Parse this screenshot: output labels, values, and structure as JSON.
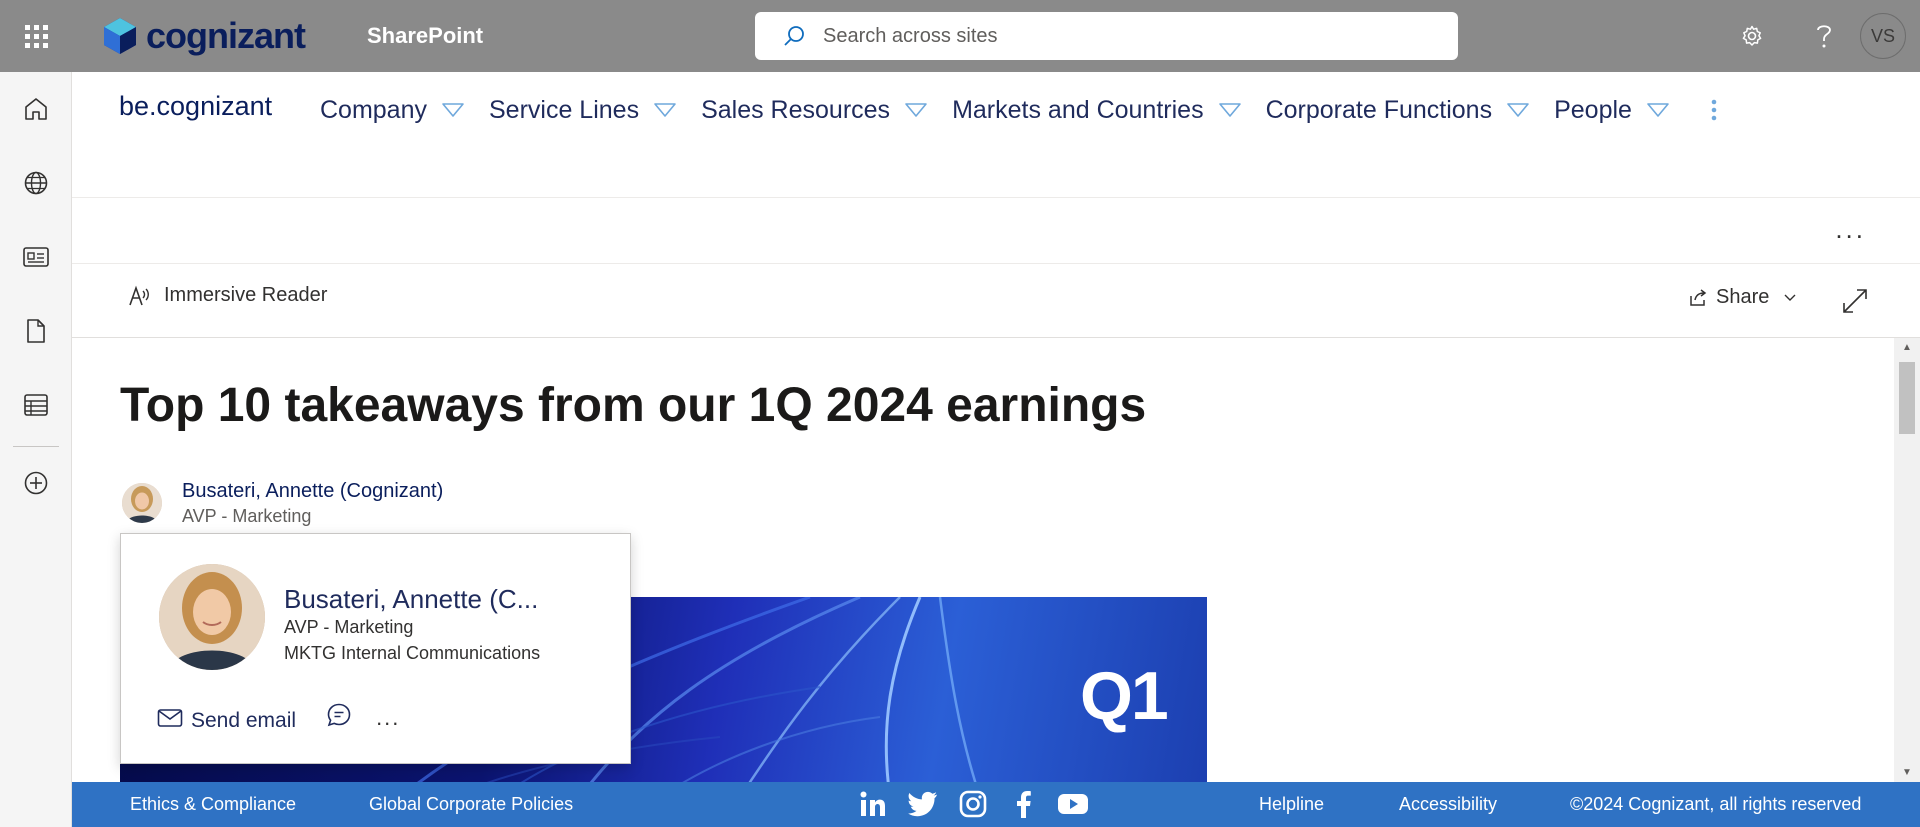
{
  "suite_bar": {
    "brand": "cognizant",
    "app_name": "SharePoint",
    "search_placeholder": "Search across sites",
    "user_initials": "VS",
    "bg_color": "#8a8a8a"
  },
  "app_bar": {
    "items": [
      "home-icon",
      "globe-icon",
      "news-icon",
      "file-icon",
      "list-icon",
      "add-icon"
    ]
  },
  "hub_nav": {
    "site_title": "be.cognizant",
    "items": [
      {
        "label": "Company"
      },
      {
        "label": "Service Lines"
      },
      {
        "label": "Sales Resources"
      },
      {
        "label": "Markets and Countries"
      },
      {
        "label": "Corporate Functions"
      },
      {
        "label": "People"
      }
    ]
  },
  "command_bar": {
    "more": "...",
    "immersive_reader": "Immersive Reader",
    "share": "Share"
  },
  "article": {
    "title": "Top 10 takeaways from our 1Q 2024 earnings",
    "author_name": "Busateri, Annette (Cognizant)",
    "author_role": "AVP - Marketing",
    "hero_text": "Q1"
  },
  "profile_card": {
    "name": "Busateri, Annette (C...",
    "title": "AVP - Marketing",
    "department": "MKTG Internal Communications",
    "send_email": "Send email",
    "more": "..."
  },
  "footer": {
    "ethics": "Ethics & Compliance",
    "policies": "Global Corporate Policies",
    "social": [
      "linkedin-icon",
      "twitter-icon",
      "instagram-icon",
      "facebook-icon",
      "youtube-icon"
    ],
    "helpline": "Helpline",
    "accessibility": "Accessibility",
    "copyright": "©2024 Cognizant, all rights reserved",
    "bg_color": "#2f72c4"
  }
}
